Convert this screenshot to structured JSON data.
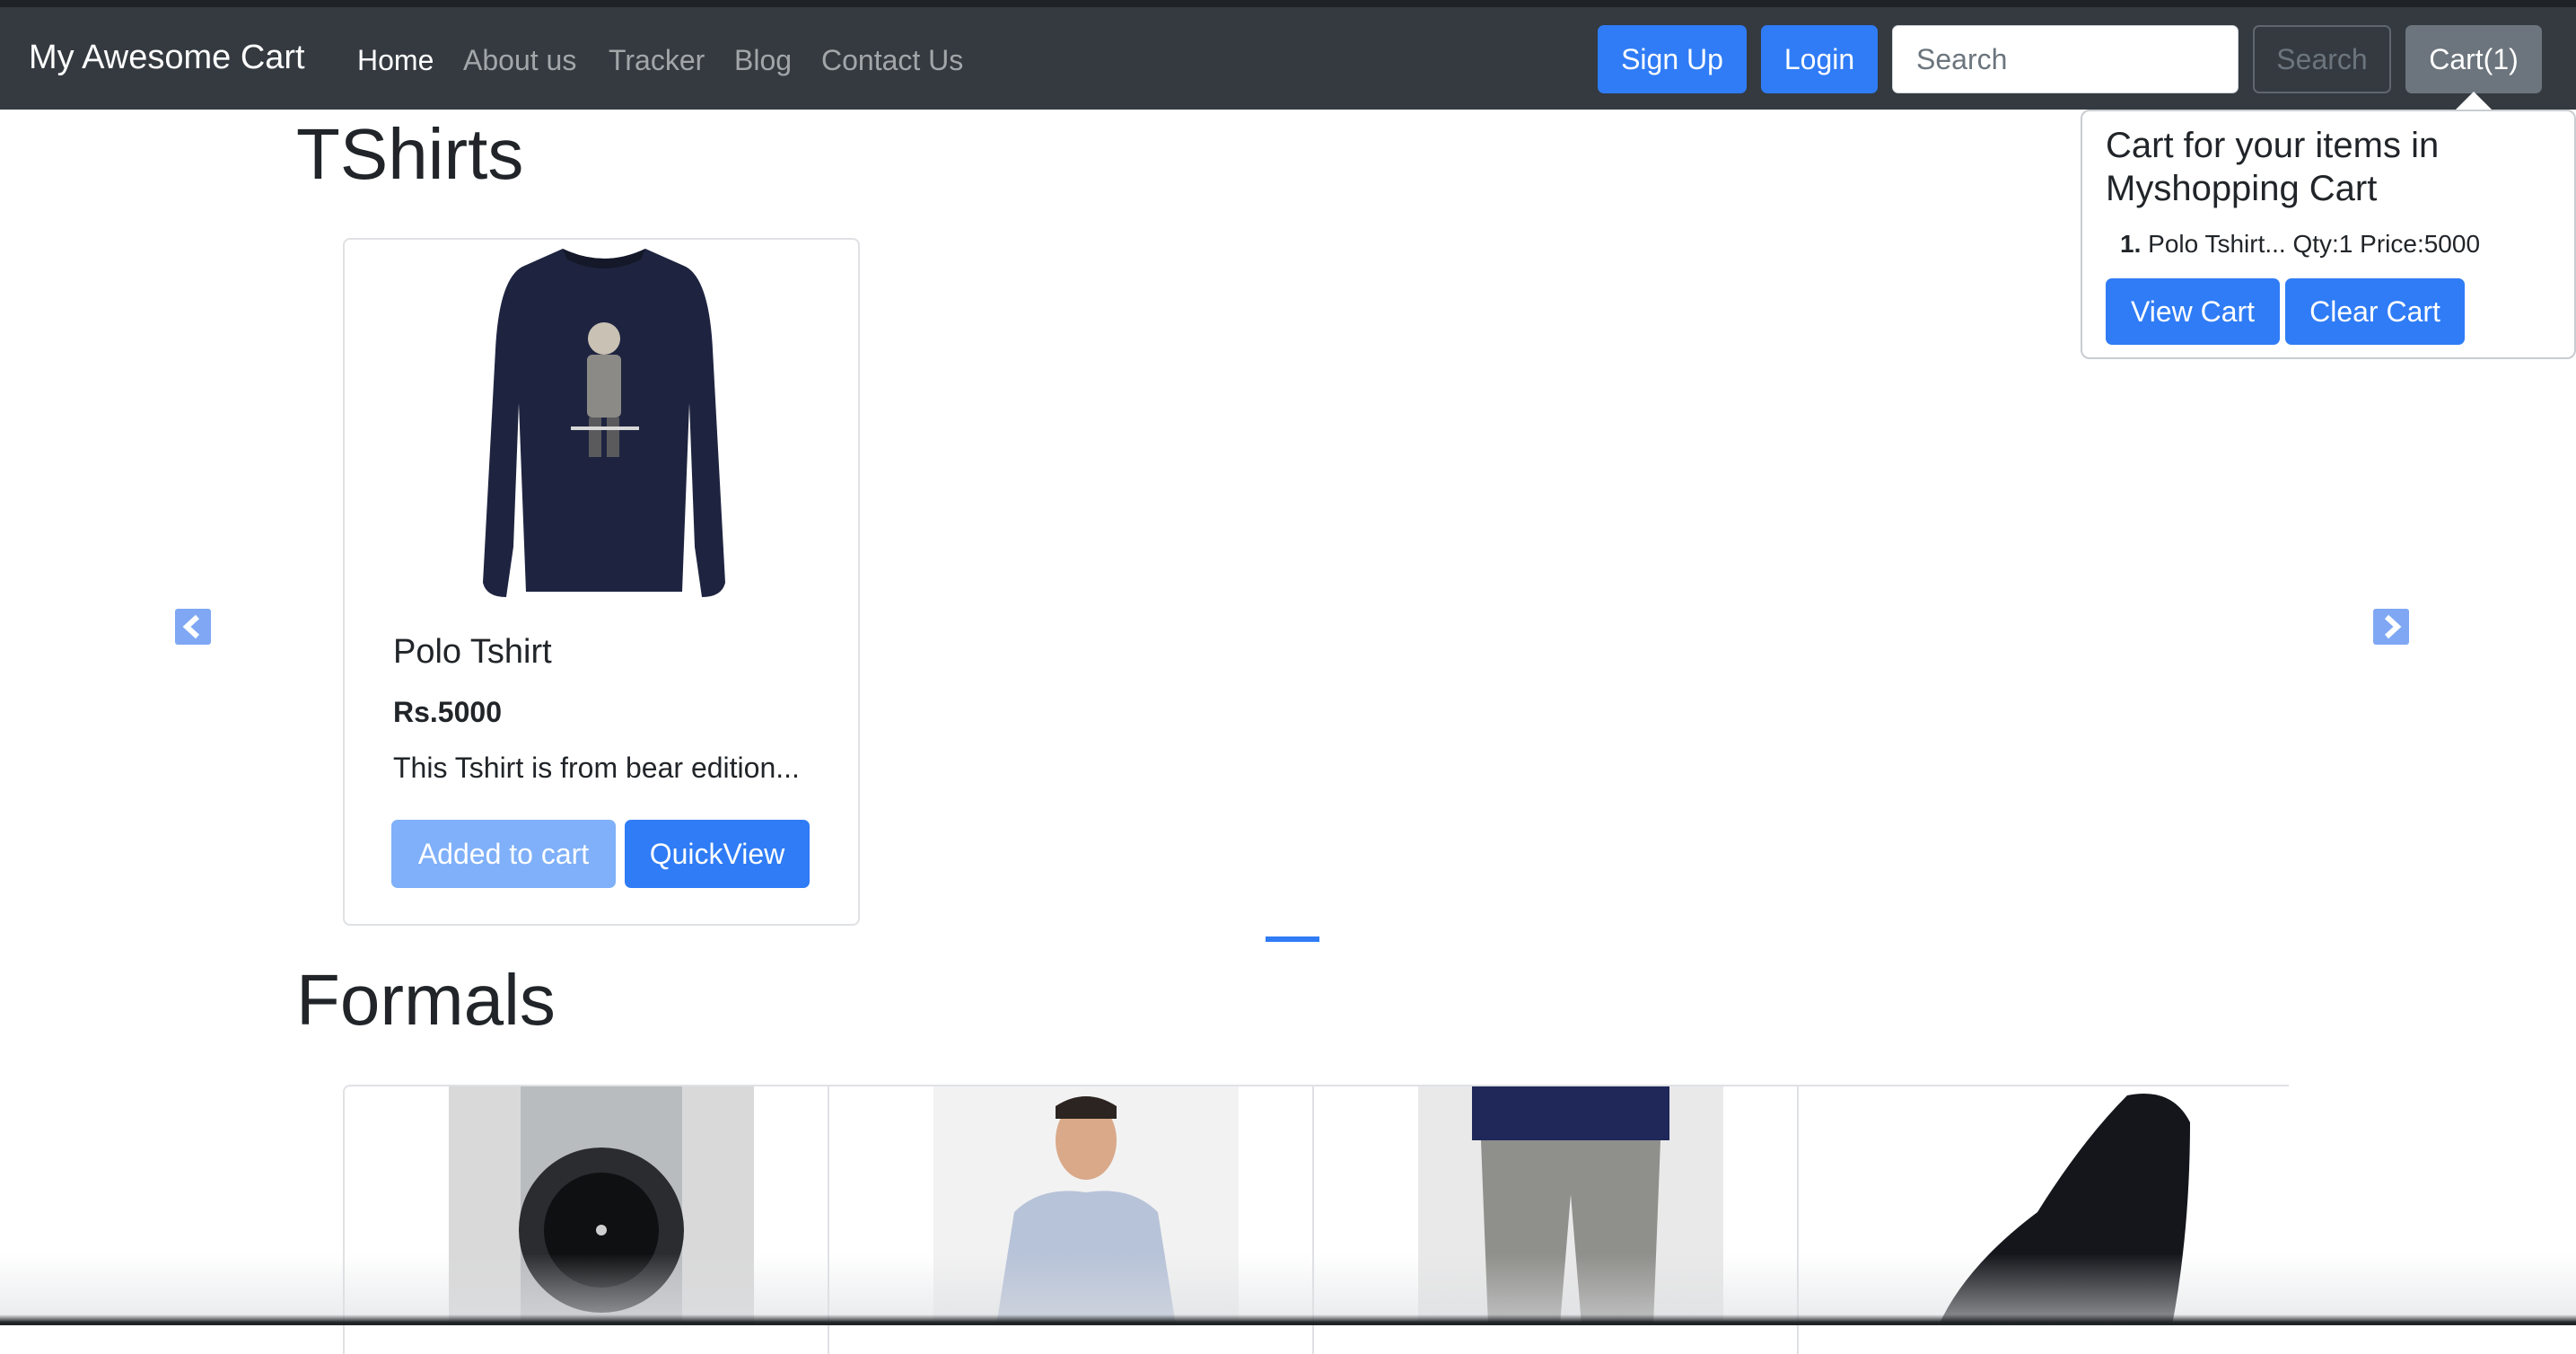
{
  "navbar": {
    "brand": "My Awesome Cart",
    "links": [
      "Home",
      "About us",
      "Tracker",
      "Blog",
      "Contact Us"
    ],
    "signup_label": "Sign Up",
    "login_label": "Login",
    "search_placeholder": "Search",
    "search_button_label": "Search",
    "cart_label": "Cart(1)"
  },
  "cart_popover": {
    "title": "Cart for your items in Myshopping Cart",
    "items": [
      {
        "index": "1.",
        "text": "Polo Tshirt... Qty:1 Price:5000"
      }
    ],
    "view_cart_label": "View Cart",
    "clear_cart_label": "Clear Cart"
  },
  "sections": {
    "tshirts": {
      "title": "TShirts",
      "product": {
        "name": "Polo Tshirt",
        "price": "Rs.5000",
        "description": "This Tshirt is from bear edition...",
        "add_label": "Added to cart",
        "quickview_label": "QuickView"
      }
    },
    "formals": {
      "title": "Formals",
      "products": [
        "watch",
        "checked shirt",
        "trousers",
        "leather shoe"
      ]
    }
  },
  "colors": {
    "navbar": "#343a40",
    "primary": "#2f7cf6",
    "primary_disabled": "#7fb0f9",
    "secondary": "#6c757d"
  },
  "icons": {
    "prev": "chevron-left-icon",
    "next": "chevron-right-icon"
  }
}
